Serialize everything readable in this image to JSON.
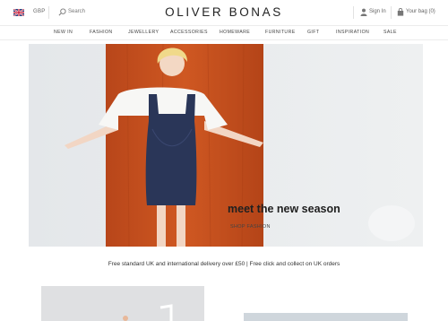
{
  "header": {
    "currency": "GBP",
    "search_label": "Search",
    "logo": "OLIVER BONAS",
    "signin": "Sign In",
    "bag": "Your bag (0)"
  },
  "nav": {
    "items": [
      "NEW IN",
      "FASHION",
      "JEWELLERY",
      "ACCESSORIES",
      "HOMEWARE",
      "FURNITURE",
      "GIFT",
      "INSPIRATION",
      "SALE"
    ]
  },
  "hero": {
    "title": "meet the new season",
    "subtitle": "SHOP FASHION"
  },
  "banner": {
    "delivery": "Free standard UK and international delivery over £50 | Free click and collect on UK orders"
  },
  "colors": {
    "accent_orange": "#c8501f",
    "dress": "#2a3658"
  }
}
